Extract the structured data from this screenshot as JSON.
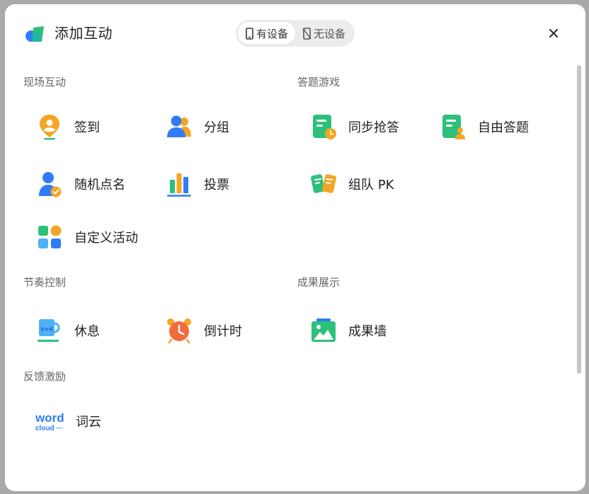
{
  "header": {
    "title": "添加互动",
    "toggle": {
      "with_device": "有设备",
      "without_device": "无设备"
    }
  },
  "sections": {
    "live": {
      "title": "现场互动",
      "items": [
        "签到",
        "分组",
        "随机点名",
        "投票",
        "自定义活动"
      ]
    },
    "quiz": {
      "title": "答题游戏",
      "items": [
        "同步抢答",
        "自由答题",
        "组队 PK"
      ]
    },
    "rhythm": {
      "title": "节奏控制",
      "items": [
        "休息",
        "倒计时"
      ]
    },
    "showcase": {
      "title": "成果展示",
      "items": [
        "成果墙"
      ]
    },
    "feedback": {
      "title": "反馈激励",
      "items": [
        "词云"
      ]
    }
  },
  "wordcloud_icon": {
    "word": "word",
    "cloud": "cloud"
  },
  "colors": {
    "orange": "#f5a524",
    "blue": "#2f7cf6",
    "green": "#2ec07a",
    "red_orange": "#f46b3b",
    "toggle_bg": "#ececec"
  }
}
